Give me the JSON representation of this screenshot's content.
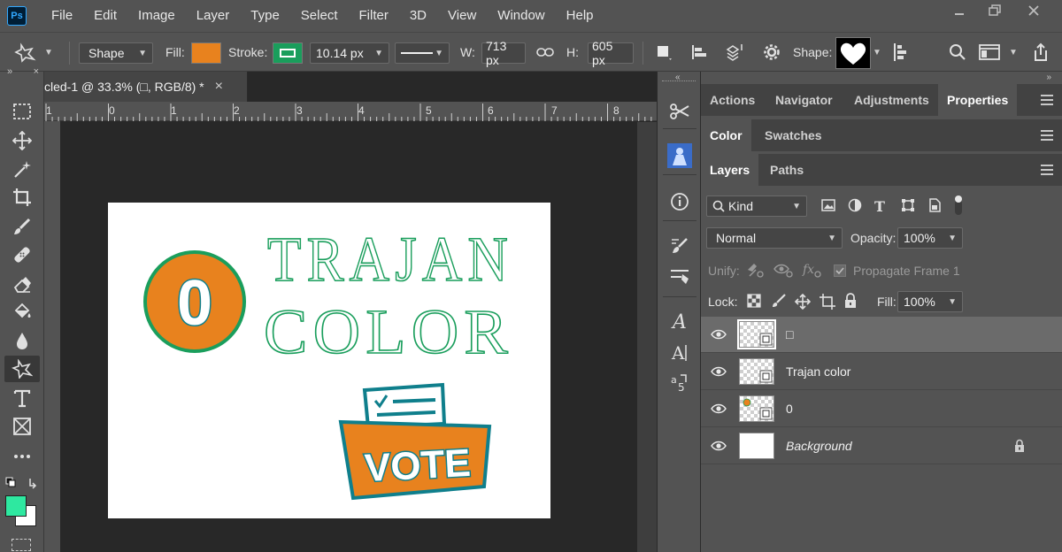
{
  "app": {
    "menu": [
      "File",
      "Edit",
      "Image",
      "Layer",
      "Type",
      "Select",
      "Filter",
      "3D",
      "View",
      "Window",
      "Help"
    ],
    "logo": "Ps"
  },
  "options_bar": {
    "tool_mode": "Shape",
    "fill_label": "Fill:",
    "fill_color": "#e8821e",
    "stroke_label": "Stroke:",
    "stroke_color": "#1a9e5c",
    "stroke_width": "10.14 px",
    "w_label": "W:",
    "w_value": "713 px",
    "h_label": "H:",
    "h_value": "605 px",
    "shape_label": "Shape:"
  },
  "document": {
    "tab_title": "cled-1 @ 33.3% (□, RGB/8) *",
    "close_glyph": "×",
    "ruler_labels": [
      "1",
      "0",
      "1",
      "2",
      "3",
      "4",
      "5",
      "6",
      "7",
      "8"
    ],
    "artwork": {
      "circle_number": "0",
      "title_line1": "TRAJAN",
      "title_line2": "COLOR",
      "vote_text": "VOTE",
      "orange": "#e8821e",
      "green": "#1a9e5c",
      "teal": "#0f7f8c"
    }
  },
  "panels": {
    "tabs_top": [
      "Actions",
      "Navigator",
      "Adjustments",
      "Properties"
    ],
    "tabs_color": [
      "Color",
      "Swatches"
    ],
    "tabs_layers": [
      "Layers",
      "Paths"
    ],
    "kind_label": "Kind",
    "blend_mode": "Normal",
    "opacity_label": "Opacity:",
    "opacity_value": "100%",
    "unify_label": "Unify:",
    "propagate_label": "Propagate Frame 1",
    "lock_label": "Lock:",
    "fill_label": "Fill:",
    "fill_value": "100%",
    "layers": [
      {
        "name": "□",
        "selected": true
      },
      {
        "name": "Trajan color",
        "selected": false
      },
      {
        "name": "0",
        "selected": false
      },
      {
        "name": "Background",
        "selected": false
      }
    ]
  }
}
